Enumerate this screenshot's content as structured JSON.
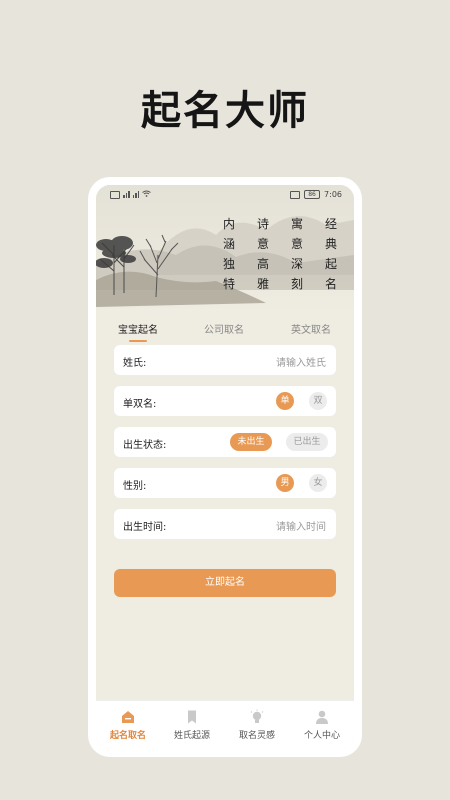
{
  "promo_title": "起名大师",
  "status_bar": {
    "left_indicators": "4G 4G",
    "battery": "86",
    "time": "7:06"
  },
  "banner": {
    "poem_lines": [
      "内",
      "诗",
      "寓",
      "经",
      "涵",
      "意",
      "意",
      "典",
      "独",
      "高",
      "深",
      "起",
      "特",
      "雅",
      "刻",
      "名"
    ]
  },
  "tabs": [
    {
      "label": "宝宝起名",
      "active": true
    },
    {
      "label": "公司取名",
      "active": false
    },
    {
      "label": "英文取名",
      "active": false
    }
  ],
  "form": {
    "surname": {
      "label": "姓氏:",
      "placeholder": "请输入姓氏"
    },
    "name_type": {
      "label": "单双名:",
      "option_single": "单",
      "option_double": "双",
      "selected": "单"
    },
    "birth_status": {
      "label": "出生状态:",
      "option_unborn": "未出生",
      "option_born": "已出生",
      "selected": "未出生"
    },
    "gender": {
      "label": "性别:",
      "option_male": "男",
      "option_female": "女",
      "selected": "男"
    },
    "birth_time": {
      "label": "出生时间:",
      "placeholder": "请输入时间"
    }
  },
  "submit_label": "立即起名",
  "bottom_nav": [
    {
      "label": "起名取名",
      "icon": "home-icon",
      "active": true
    },
    {
      "label": "姓氏起源",
      "icon": "bookmark-icon",
      "active": false
    },
    {
      "label": "取名灵感",
      "icon": "lightbulb-icon",
      "active": false
    },
    {
      "label": "个人中心",
      "icon": "user-icon",
      "active": false
    }
  ],
  "colors": {
    "accent": "#e89a55",
    "page_bg": "#e7e4dc",
    "screen_bg": "#efece2"
  }
}
